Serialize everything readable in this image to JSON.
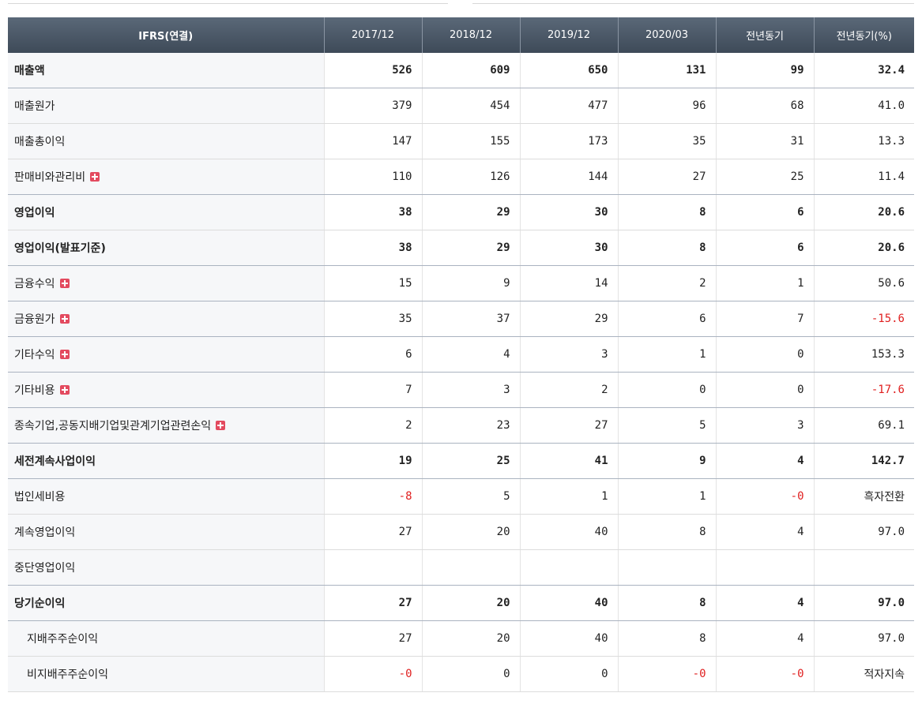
{
  "header": {
    "label": "IFRS(연결)",
    "columns": [
      "2017/12",
      "2018/12",
      "2019/12",
      "2020/03",
      "전년동기",
      "전년동기(%)"
    ]
  },
  "rows": [
    {
      "label": "매출액",
      "bold": true,
      "expand": false,
      "indent": false,
      "values": [
        "526",
        "609",
        "650",
        "131",
        "99",
        "32.4"
      ]
    },
    {
      "label": "매출원가",
      "bold": false,
      "expand": false,
      "indent": false,
      "values": [
        "379",
        "454",
        "477",
        "96",
        "68",
        "41.0"
      ]
    },
    {
      "label": "매출총이익",
      "bold": false,
      "expand": false,
      "indent": false,
      "values": [
        "147",
        "155",
        "173",
        "35",
        "31",
        "13.3"
      ]
    },
    {
      "label": "판매비와관리비",
      "bold": false,
      "expand": true,
      "indent": false,
      "values": [
        "110",
        "126",
        "144",
        "27",
        "25",
        "11.4"
      ]
    },
    {
      "label": "영업이익",
      "bold": true,
      "expand": false,
      "indent": false,
      "values": [
        "38",
        "29",
        "30",
        "8",
        "6",
        "20.6"
      ]
    },
    {
      "label": "영업이익(발표기준)",
      "bold": true,
      "expand": false,
      "indent": false,
      "values": [
        "38",
        "29",
        "30",
        "8",
        "6",
        "20.6"
      ]
    },
    {
      "label": "금융수익",
      "bold": false,
      "expand": true,
      "indent": false,
      "values": [
        "15",
        "9",
        "14",
        "2",
        "1",
        "50.6"
      ]
    },
    {
      "label": "금융원가",
      "bold": false,
      "expand": true,
      "indent": false,
      "values": [
        "35",
        "37",
        "29",
        "6",
        "7",
        "-15.6"
      ]
    },
    {
      "label": "기타수익",
      "bold": false,
      "expand": true,
      "indent": false,
      "values": [
        "6",
        "4",
        "3",
        "1",
        "0",
        "153.3"
      ]
    },
    {
      "label": "기타비용",
      "bold": false,
      "expand": true,
      "indent": false,
      "values": [
        "7",
        "3",
        "2",
        "0",
        "0",
        "-17.6"
      ]
    },
    {
      "label": "종속기업,공동지배기업및관계기업관련손익",
      "bold": false,
      "expand": true,
      "indent": false,
      "values": [
        "2",
        "23",
        "27",
        "5",
        "3",
        "69.1"
      ]
    },
    {
      "label": "세전계속사업이익",
      "bold": true,
      "expand": false,
      "indent": false,
      "values": [
        "19",
        "25",
        "41",
        "9",
        "4",
        "142.7"
      ]
    },
    {
      "label": "법인세비용",
      "bold": false,
      "expand": false,
      "indent": false,
      "values": [
        "-8",
        "5",
        "1",
        "1",
        "-0",
        "흑자전환"
      ]
    },
    {
      "label": "계속영업이익",
      "bold": false,
      "expand": false,
      "indent": false,
      "values": [
        "27",
        "20",
        "40",
        "8",
        "4",
        "97.0"
      ]
    },
    {
      "label": "중단영업이익",
      "bold": false,
      "expand": false,
      "indent": false,
      "values": [
        "",
        "",
        "",
        "",
        "",
        ""
      ]
    },
    {
      "label": "당기순이익",
      "bold": true,
      "expand": false,
      "indent": false,
      "values": [
        "27",
        "20",
        "40",
        "8",
        "4",
        "97.0"
      ]
    },
    {
      "label": "지배주주순이익",
      "bold": false,
      "expand": false,
      "indent": true,
      "values": [
        "27",
        "20",
        "40",
        "8",
        "4",
        "97.0"
      ]
    },
    {
      "label": "비지배주주순이익",
      "bold": false,
      "expand": false,
      "indent": true,
      "values": [
        "-0",
        "0",
        "0",
        "-0",
        "-0",
        "적자지속"
      ]
    }
  ],
  "colors": {
    "negative": "#e02020",
    "header_bg": "#4a5665",
    "expand_icon": "#e34a5f"
  }
}
